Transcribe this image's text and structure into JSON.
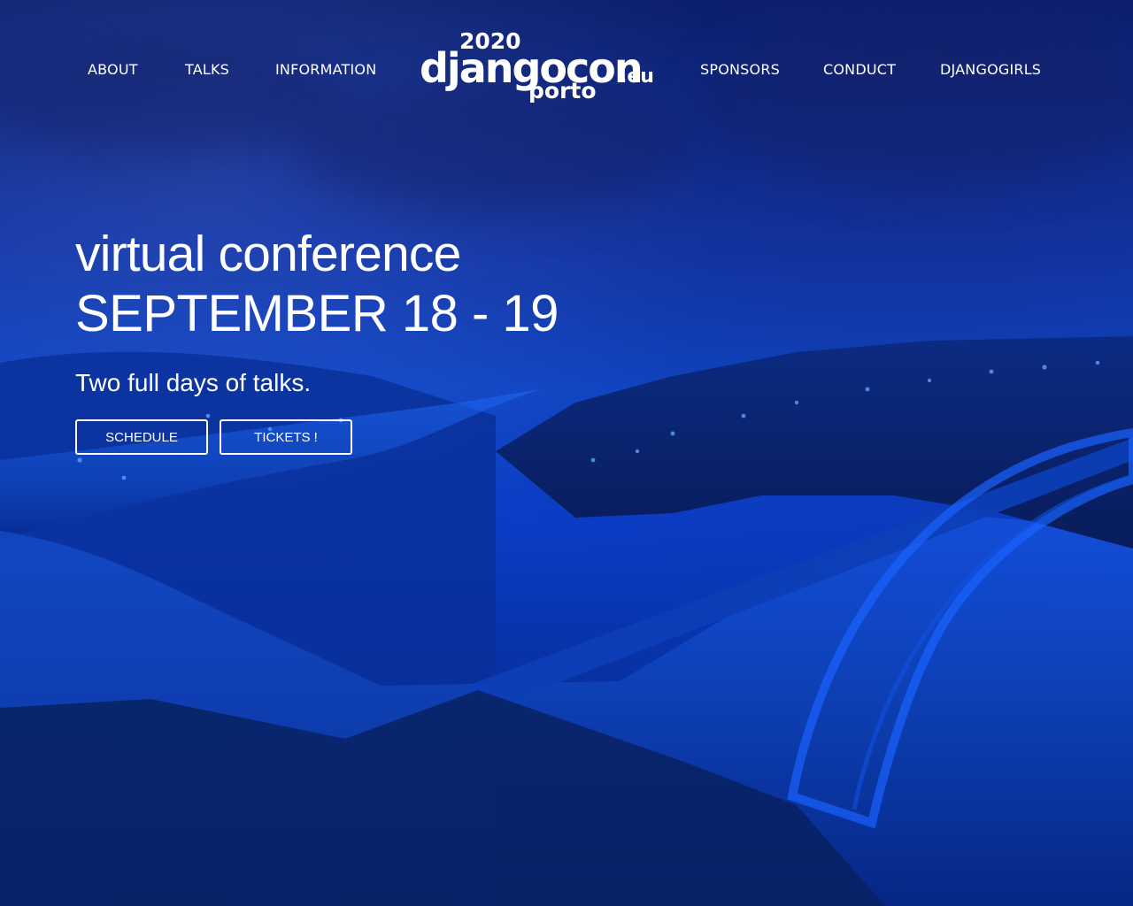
{
  "navigation": {
    "left_items": [
      {
        "label": "ABOUT"
      },
      {
        "label": "TALKS"
      },
      {
        "label": "INFORMATION"
      }
    ],
    "right_items": [
      {
        "label": "SPONSORS"
      },
      {
        "label": "CONDUCT"
      },
      {
        "label": "DJANGOGIRLS"
      }
    ],
    "logo": {
      "year": "2020",
      "name": "djangocon",
      "suffix": ".eu",
      "city": "porto"
    }
  },
  "hero": {
    "line1": "virtual conference",
    "line2": "SEPTEMBER 18 - 19",
    "subtitle": "Two full days of talks.",
    "buttons": [
      {
        "label": "SCHEDULE"
      },
      {
        "label": "TICKETS !"
      }
    ]
  },
  "colors": {
    "overlay_blue": "#0f47c8",
    "deep_blue": "#08206f",
    "text": "#ffffff"
  }
}
